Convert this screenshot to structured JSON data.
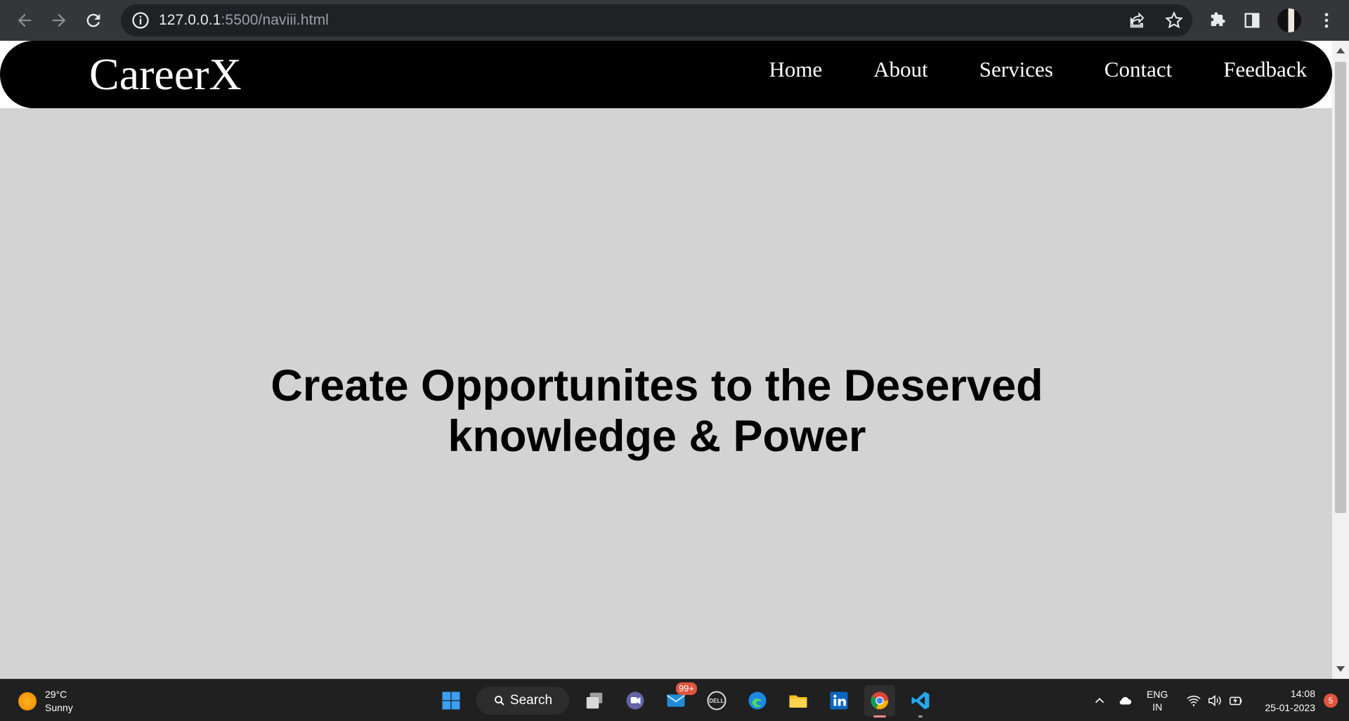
{
  "browser": {
    "url_host": "127.0.0.1",
    "url_path": ":5500/naviii.html"
  },
  "site": {
    "logo": "CareerX",
    "menu": [
      "Home",
      "About",
      "Services",
      "Contact",
      "Feedback"
    ],
    "hero_line1": "Create Opportunites to the Deserved",
    "hero_line2": "knowledge & Power"
  },
  "taskbar": {
    "weather_temp": "29°C",
    "weather_desc": "Sunny",
    "search_label": "Search",
    "mail_badge": "99+",
    "language": "ENG",
    "region": "IN",
    "time": "14:08",
    "date": "25-01-2023",
    "notifications": "5"
  },
  "colors": {
    "nav_background": "#000000",
    "page_background": "#d3d3d3",
    "taskbar": "#202020"
  }
}
